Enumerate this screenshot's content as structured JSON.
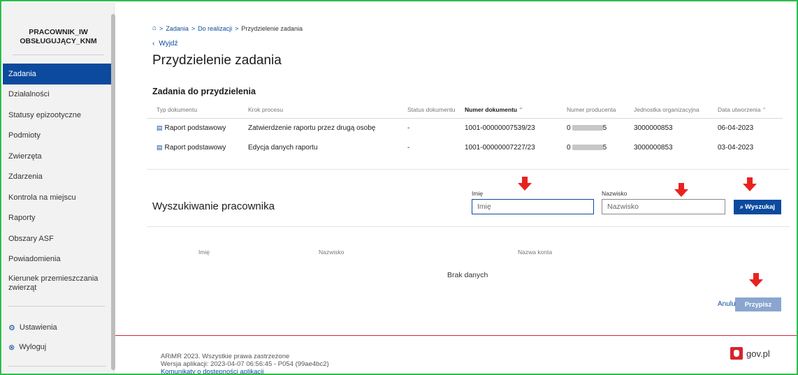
{
  "sidebar": {
    "user_line1": "PRACOWNIK_IW",
    "user_line2": "OBSŁUGUJĄCY_KNM",
    "items": [
      {
        "label": "Zadania"
      },
      {
        "label": "Działalności"
      },
      {
        "label": "Statusy epizootyczne"
      },
      {
        "label": "Podmioty"
      },
      {
        "label": "Zwierzęta"
      },
      {
        "label": "Zdarzenia"
      },
      {
        "label": "Kontrola na miejscu"
      },
      {
        "label": "Raporty"
      },
      {
        "label": "Obszary ASF"
      },
      {
        "label": "Powiadomienia"
      },
      {
        "label": "Kierunek przemieszczania zwierząt"
      }
    ],
    "settings_label": "Ustawienia",
    "logout_label": "Wyloguj"
  },
  "breadcrumb": {
    "home_icon": "home-icon",
    "items": [
      "Zadania",
      "Do realizacji",
      "Przydzielenie zadania"
    ],
    "separator": ">"
  },
  "back_label": "Wyjdź",
  "page_title": "Przydzielenie zadania",
  "tasks": {
    "title": "Zadania do przydzielenia",
    "columns": [
      "Typ dokumentu",
      "Krok procesu",
      "Status dokumentu",
      "Numer dokumentu",
      "Numer producenta",
      "Jednostka organizacyjna",
      "Data utworzenia"
    ],
    "rows": [
      {
        "type": "Raport podstawowy",
        "step": "Zatwierdzenie raportu przez drugą osobę",
        "status": "-",
        "number": "1001-00000007539/23",
        "producer_prefix": "0",
        "producer_suffix": "5",
        "unit": "3000000853",
        "date": "06-04-2023"
      },
      {
        "type": "Raport podstawowy",
        "step": "Edycja danych raportu",
        "status": "-",
        "number": "1001-00000007227/23",
        "producer_prefix": "0",
        "producer_suffix": "5",
        "unit": "3000000853",
        "date": "03-04-2023"
      }
    ]
  },
  "search": {
    "title": "Wyszukiwanie pracownika",
    "first_name_label": "Imię",
    "first_name_placeholder": "Imię",
    "last_name_label": "Nazwisko",
    "last_name_placeholder": "Nazwisko",
    "button_label": "Wyszukaj"
  },
  "results": {
    "columns": [
      "Imię",
      "Nazwisko",
      "Nazwa konta"
    ],
    "empty_text": "Brak danych"
  },
  "actions": {
    "cancel_label": "Anuluj",
    "assign_label": "Przypisz"
  },
  "footer": {
    "copyright": "ARiMR 2023. Wszystkie prawa zastrzeżone",
    "version": "Wersja aplikacji: 2023-04-07 06:56:45 - P054 (99ae4bc2)",
    "accessibility_link": "Komunikaty o dostępności aplikacji",
    "gov_label": "gov.pl"
  },
  "colors": {
    "primary": "#0c4a9e",
    "annotation_arrow": "#e8231f",
    "footer_line": "#d9232e",
    "frame": "#2ebd4a"
  }
}
